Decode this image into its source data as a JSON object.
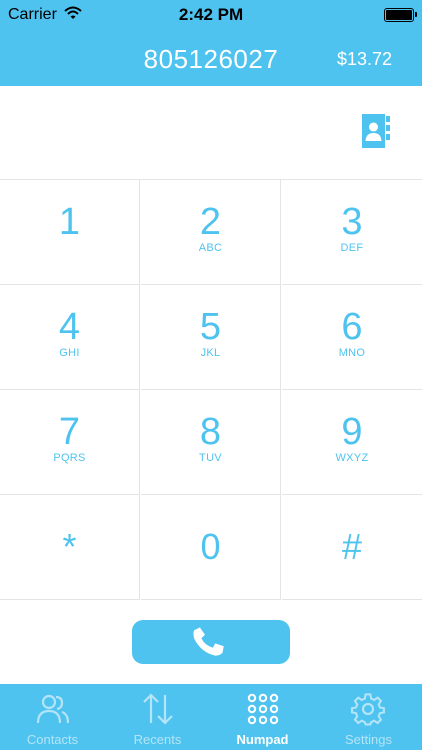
{
  "status_bar": {
    "carrier": "Carrier",
    "time": "2:42 PM"
  },
  "header": {
    "number": "805126027",
    "balance": "$13.72"
  },
  "keypad": {
    "keys": [
      {
        "digit": "1",
        "letters": ""
      },
      {
        "digit": "2",
        "letters": "ABC"
      },
      {
        "digit": "3",
        "letters": "DEF"
      },
      {
        "digit": "4",
        "letters": "GHI"
      },
      {
        "digit": "5",
        "letters": "JKL"
      },
      {
        "digit": "6",
        "letters": "MNO"
      },
      {
        "digit": "7",
        "letters": "PQRS"
      },
      {
        "digit": "8",
        "letters": "TUV"
      },
      {
        "digit": "9",
        "letters": "WXYZ"
      },
      {
        "digit": "*",
        "letters": ""
      },
      {
        "digit": "0",
        "letters": ""
      },
      {
        "digit": "#",
        "letters": ""
      }
    ]
  },
  "tabs": [
    {
      "label": "Contacts",
      "icon": "contacts-icon",
      "active": false
    },
    {
      "label": "Recents",
      "icon": "recents-icon",
      "active": false
    },
    {
      "label": "Numpad",
      "icon": "numpad-icon",
      "active": true
    },
    {
      "label": "Settings",
      "icon": "settings-icon",
      "active": false
    }
  ],
  "colors": {
    "accent": "#4fc3ef",
    "tab_inactive": "#b3e4f7",
    "tab_active": "#ffffff"
  }
}
